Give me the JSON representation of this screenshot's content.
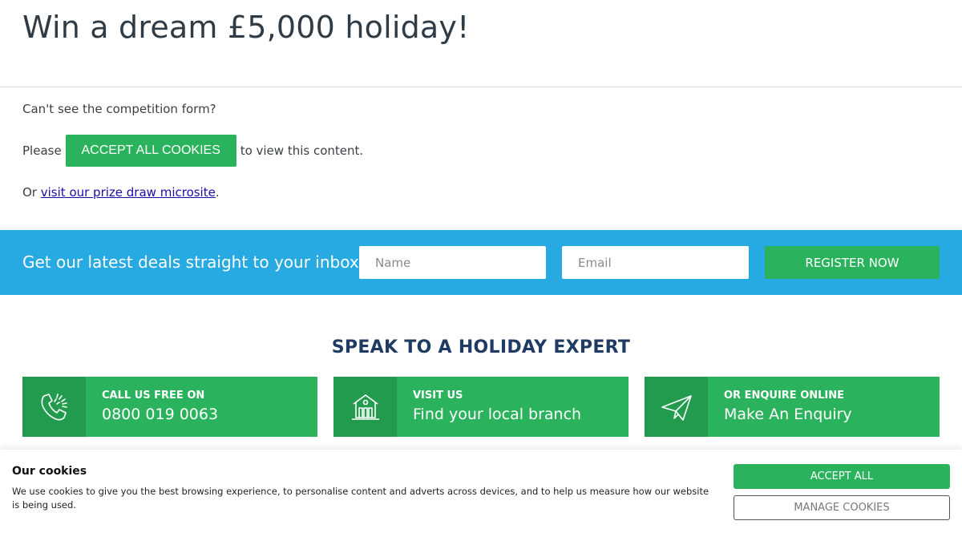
{
  "hero": {
    "title": "Win a dream £5,000 holiday!"
  },
  "notice": {
    "question": "Can't see the competition form?",
    "please": "Please",
    "accept_button": "ACCEPT ALL COOKIES",
    "to_view": "to view this content.",
    "or_prefix": "Or",
    "microsite_link": "visit our prize draw microsite",
    "or_suffix": "."
  },
  "newsletter": {
    "title": "Get our latest deals straight to your inbox",
    "name_placeholder": "Name",
    "email_placeholder": "Email",
    "register_button": "REGISTER NOW"
  },
  "expert": {
    "heading": "SPEAK TO A HOLIDAY EXPERT",
    "cards": [
      {
        "icon": "phone-icon",
        "small": "CALL US FREE ON",
        "big": "0800 019 0063"
      },
      {
        "icon": "branch-building-icon",
        "small": "VISIT US",
        "big": "Find your local branch"
      },
      {
        "icon": "paper-plane-icon",
        "small": "OR ENQUIRE ONLINE",
        "big": "Make An Enquiry"
      }
    ]
  },
  "cookies": {
    "title": "Our cookies",
    "text": "We use cookies to give you the best browsing experience, to personalise content and adverts across devices, and to help us measure how our website is being used.",
    "accept_all": "ACCEPT ALL",
    "manage": "MANAGE COOKIES"
  },
  "colors": {
    "green": "#2bb25c",
    "green_dark": "#239b4f",
    "blue": "#27a9e1",
    "navy": "#1f3b63"
  }
}
